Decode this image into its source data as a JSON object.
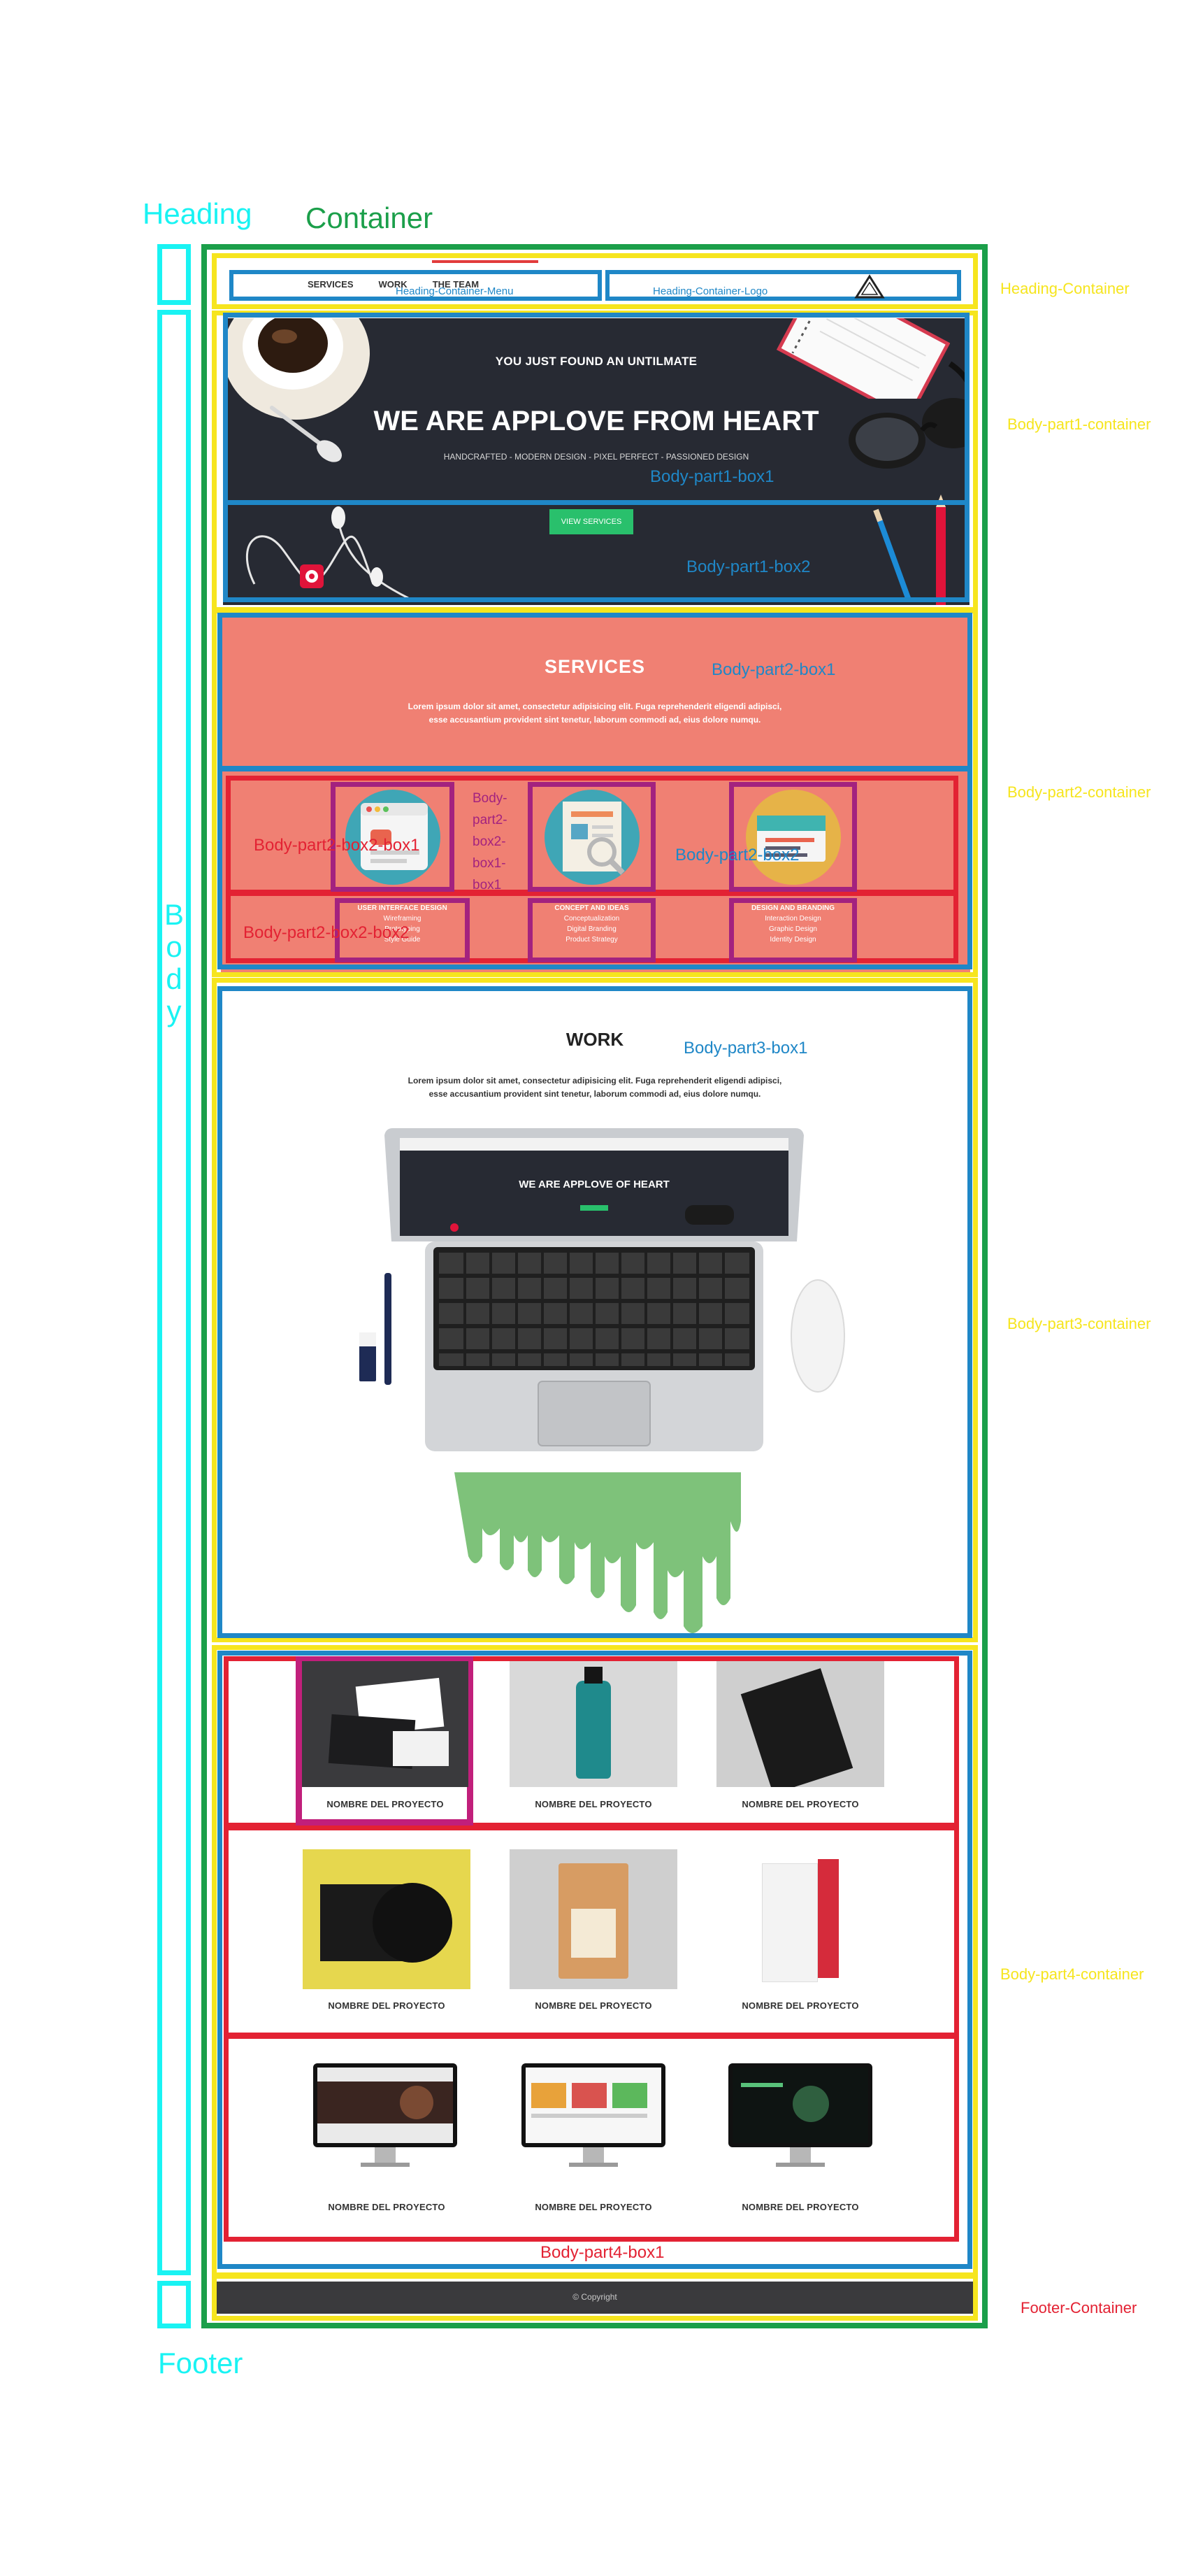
{
  "labels": {
    "heading": "Heading",
    "container": "Container",
    "body": "Body",
    "footer": "Footer",
    "heading_container": "Heading-Container",
    "body_part1_container": "Body-part1-container",
    "body_part2_container": "Body-part2-container",
    "body_part3_container": "Body-part3-container",
    "body_part4_container": "Body-part4-container",
    "footer_container": "Footer-Container",
    "heading_container_menu": "Heading-Container-Menu",
    "heading_container_logo": "Heading-Container-Logo",
    "body_part1_box1": "Body-part1-box1",
    "body_part1_box2": "Body-part1-box2",
    "body_part2_box1": "Body-part2-box1",
    "body_part2_box2": "Body-part2-box2",
    "body_part2_box2_box1": "Body-part2-box2-box1",
    "body_part2_box2_box1_box1": "Body-part2-box2-box1-box1",
    "body_part2_box2_box2": "Body-part2-box2-box2",
    "body_part3_box1": "Body-part3-box1",
    "body_part4_box1": "Body-part4-box1"
  },
  "nav": {
    "items": [
      "SERVICES",
      "WORK",
      "THE TEAM"
    ]
  },
  "hero": {
    "kicker": "YOU JUST FOUND AN UNTILMATE",
    "title": "WE ARE APPLOVE FROM HEART",
    "subtitle": "HANDCRAFTED - MODERN DESIGN - PIXEL PERFECT - PASSIONED DESIGN",
    "button": "VIEW SERVICES"
  },
  "services": {
    "title": "SERVICES",
    "text1": "Lorem ipsum dolor sit amet, consectetur adipisicing elit. Fuga reprehenderit eligendi adipisci,",
    "text2": "esse accusantium provident sint tenetur, laborum commodi ad, eius dolore numqu.",
    "items": [
      {
        "title": "USER INTERFACE DESIGN",
        "lines": [
          "Wireframing",
          "Prototyping",
          "Style Guide"
        ]
      },
      {
        "title": "CONCEPT AND IDEAS",
        "lines": [
          "Conceptualization",
          "Digital Branding",
          "Product Strategy"
        ]
      },
      {
        "title": "DESIGN AND BRANDING",
        "lines": [
          "Interaction Design",
          "Graphic Design",
          "Identity Design"
        ]
      }
    ]
  },
  "work": {
    "title": "WORK",
    "text1": "Lorem ipsum dolor sit amet, consectetur adipisicing elit. Fuga reprehenderit eligendi adipisci,",
    "text2": "esse accusantium provident sint tenetur, laborum commodi ad, eius dolore numqu.",
    "screen_title": "WE ARE APPLOVE OF HEART"
  },
  "projects": {
    "caption": "NOMBRE DEL PROYECTO"
  },
  "footer": {
    "copyright": "© Copyright"
  },
  "colors": {
    "cyan": "#19f3f3",
    "green": "#1b9f4a",
    "yellow": "#f6e51e",
    "blue": "#1f87c7",
    "red": "#e32233",
    "magenta": "#a3227f",
    "salmon": "#f08073",
    "dark": "#272a33",
    "accent_green": "#29c06c"
  }
}
